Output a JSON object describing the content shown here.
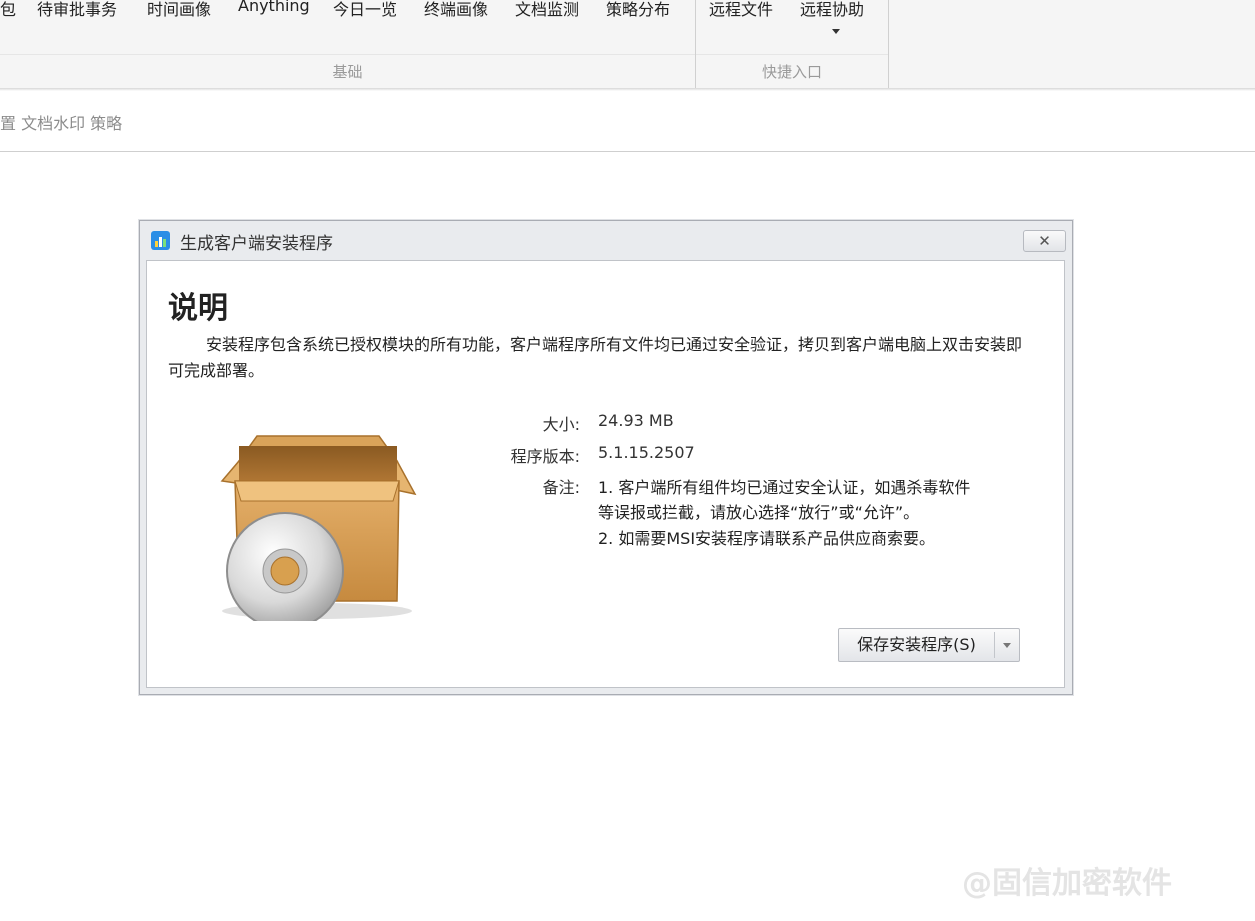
{
  "ribbon": {
    "items_basic": [
      "包",
      "待审批事务",
      "时间画像",
      "Anything",
      "今日一览",
      "终端画像",
      "文档监测",
      "策略分布"
    ],
    "items_quick": [
      "远程文件",
      "远程协助"
    ],
    "group_basic_label": "基础",
    "group_quick_label": "快捷入口"
  },
  "breadcrumb": "置 文档水印 策略",
  "dialog": {
    "title": "生成客户端安装程序",
    "close_label": "✕",
    "heading": "说明",
    "description": "安装程序包含系统已授权模块的所有功能，客户端程序所有文件均已通过安全验证，拷贝到客户端电脑上双击安装即可完成部署。",
    "size_label": "大小:",
    "size_value": "24.93 MB",
    "version_label": "程序版本:",
    "version_value": "5.1.15.2507",
    "notes_label": "备注:",
    "notes": [
      "1. 客户端所有组件均已通过安全认证，如遇杀毒软件",
      "等误报或拦截，请放心选择“放行”或“允许”。",
      "2. 如需要MSI安装程序请联系产品供应商索要。"
    ],
    "save_button": "保存安装程序(S)"
  },
  "watermark": "@固信加密软件",
  "colors": {
    "app_icon": "#2a8ee6",
    "box": "#d9a35a",
    "disc": "#dcdcdc"
  }
}
